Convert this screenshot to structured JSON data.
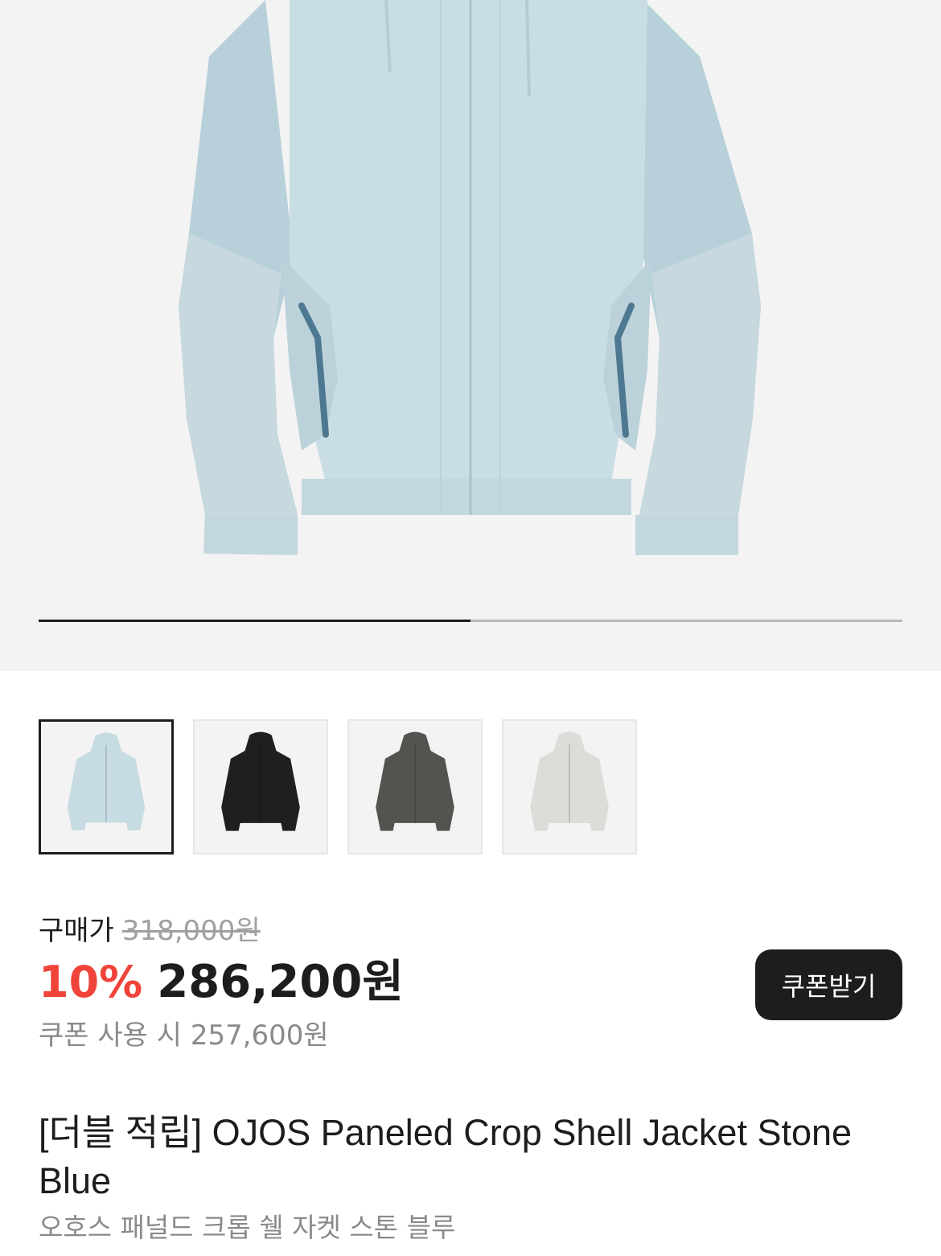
{
  "gallery": {
    "main_image": "jacket-stone-blue",
    "current_index": 1,
    "total_images": 2,
    "progress_fraction": 0.5,
    "thumbnails": [
      {
        "color_name": "Stone Blue",
        "hex": "#c7dbe3",
        "active": true
      },
      {
        "color_name": "Black",
        "hex": "#1f1f1f",
        "active": false
      },
      {
        "color_name": "Charcoal",
        "hex": "#55534f",
        "active": false
      },
      {
        "color_name": "Light Grey",
        "hex": "#dcdcd8",
        "active": false
      }
    ]
  },
  "price": {
    "original_label": "구매가",
    "original_price": "318,000원",
    "discount_rate": "10%",
    "sale_price": "286,200원",
    "coupon_price_text": "쿠폰 사용 시 257,600원"
  },
  "coupon_button": {
    "label": "쿠폰받기"
  },
  "product": {
    "title": "[더블 적립] OJOS Paneled Crop Shell Jacket Stone Blue",
    "subtitle": "오호스 패널드 크롭 쉘 자켓 스톤 블루"
  },
  "colors": {
    "accent_red": "#f0443a",
    "dark": "#1d1d1d",
    "muted_text": "#8a8a8a"
  }
}
